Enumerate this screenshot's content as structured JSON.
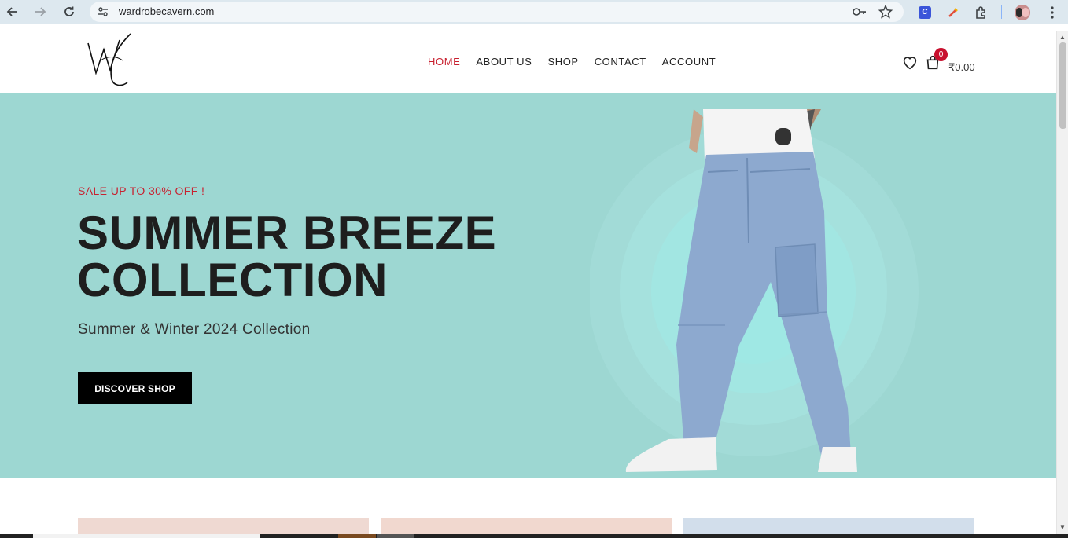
{
  "browser": {
    "url": "wardrobecavern.com"
  },
  "site": {
    "logo_text": "WC",
    "nav": [
      {
        "label": "HOME",
        "active": true
      },
      {
        "label": "ABOUT US",
        "active": false
      },
      {
        "label": "SHOP",
        "active": false
      },
      {
        "label": "CONTACT",
        "active": false
      },
      {
        "label": "ACCOUNT",
        "active": false
      }
    ],
    "cart": {
      "count": "0",
      "total": "₹0.00"
    }
  },
  "hero": {
    "sale": "SALE UP TO 30% OFF !",
    "title_line1": "SUMMER BREEZE",
    "title_line2": "COLLECTION",
    "subtitle": "Summer & Winter 2024 Collection",
    "cta": "DISCOVER SHOP",
    "background_color": "#9dd7d2",
    "accent_color": "#c8202f"
  },
  "cards": [
    {
      "color": "#efd9d2"
    },
    {
      "color": "#f1d8cf"
    },
    {
      "color": "#d2deeb"
    }
  ]
}
